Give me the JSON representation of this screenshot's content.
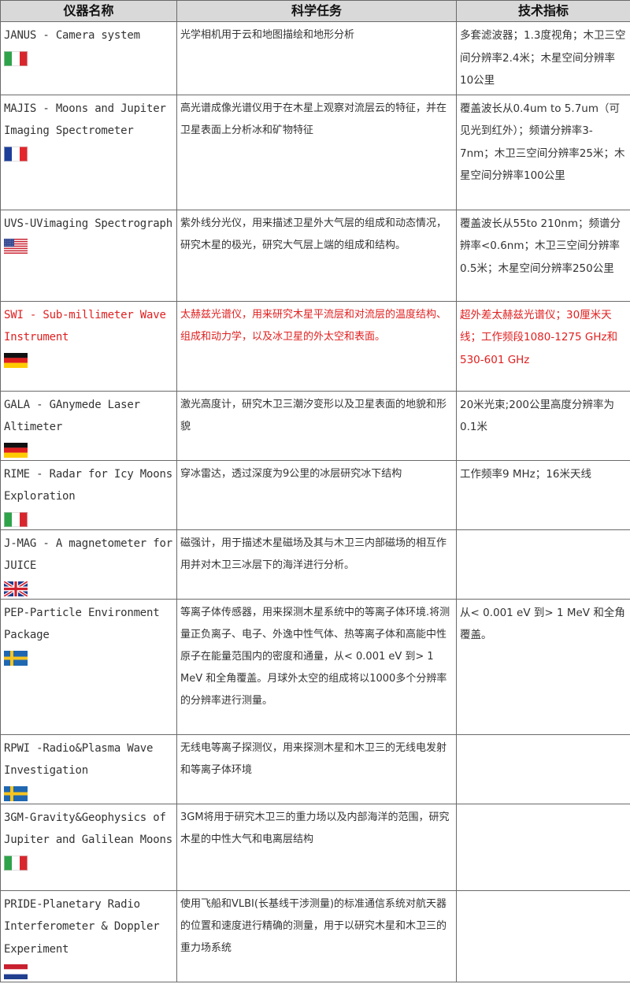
{
  "headers": [
    "仪器名称",
    "科学任务",
    "技术指标"
  ],
  "rows": [
    {
      "name": "JANUS - Camera system",
      "task": "光学相机用于云和地图描绘和地形分析",
      "spec": "多套滤波器；1.3度视角；木卫三空间分辨率2.4米；木星空间分辨率10公里",
      "flag": "italy-flag",
      "highlight": false
    },
    {
      "name": "MAJIS - Moons and Jupiter Imaging Spectrometer",
      "task": "高光谱成像光谱仪用于在木星上观察对流层云的特征，并在卫星表面上分析冰和矿物特征",
      "spec": "覆盖波长从0.4um to 5.7um（可见光到红外）；频谱分辨率3-7nm；木卫三空间分辨率25米；木星空间分辨率100公里",
      "flag": "france-flag",
      "highlight": false
    },
    {
      "name": "UVS-UVimaging Spectrograph",
      "task": "紫外线分光仪，用来描述卫星外大气层的组成和动态情况，研究木星的极光，研究大气层上端的组成和结构。",
      "spec": "覆盖波长从55to 210nm；频谱分辨率<0.6nm；木卫三空间分辨率0.5米；木星空间分辨率250公里",
      "flag": "usa-flag",
      "highlight": false
    },
    {
      "name": "SWI - Sub-millimeter Wave Instrument",
      "task": "太赫兹光谱仪，用来研究木星平流层和对流层的温度结构、组成和动力学，以及冰卫星的外太空和表面。",
      "spec": "超外差太赫兹光谱仪；30厘米天线；工作频段1080-1275 GHz和530-601 GHz",
      "flag": "germany-flag",
      "highlight": true
    },
    {
      "name": "GALA - GAnymede Laser Altimeter",
      "task": "激光高度计，研究木卫三潮汐变形以及卫星表面的地貌和形貌",
      "spec": "20米光束;200公里高度分辨率为0.1米",
      "flag": "germany-flag",
      "highlight": false
    },
    {
      "name": "RIME - Radar for Icy Moons Exploration",
      "task": "穿冰雷达，透过深度为9公里的冰层研究冰下结构",
      "spec": "工作频率9 MHz；16米天线",
      "flag": "italy-flag",
      "highlight": false
    },
    {
      "name": "J-MAG - A magnetometer for JUICE",
      "task": "磁强计，用于描述木星磁场及其与木卫三内部磁场的相互作用并对木卫三冰层下的海洋进行分析。",
      "spec": "",
      "flag": "uk-flag",
      "highlight": false
    },
    {
      "name": "PEP-Particle Environment Package",
      "task": "等离子体传感器，用来探测木星系统中的等离子体环境.将测量正负离子、电子、外逸中性气体、热等离子体和高能中性原子在能量范围内的密度和通量，从< 0.001 eV 到> 1 MeV 和全角覆盖。月球外太空的组成将以1000多个分辨率的分辨率进行测量。",
      "spec": "从< 0.001 eV 到> 1 MeV 和全角覆盖。",
      "flag": "sweden-flag",
      "highlight": false
    },
    {
      "name": "RPWI -Radio&Plasma Wave Investigation",
      "task": "无线电等离子探测仪，用来探测木星和木卫三的无线电发射和等离子体环境",
      "spec": "",
      "flag": "sweden-flag",
      "highlight": false
    },
    {
      "name": "3GM-Gravity&Geophysics of Jupiter and Galilean Moons",
      "task": "3GM将用于研究木卫三的重力场以及内部海洋的范围，研究木星的中性大气和电离层结构",
      "spec": "",
      "flag": "italy-flag",
      "highlight": false
    },
    {
      "name": "PRIDE-Planetary Radio Interferometer & Doppler Experiment",
      "task": "使用飞船和VLBI(长基线干涉测量)的标准通信系统对航天器的位置和速度进行精确的测量，用于以研究木星和木卫三的重力场系统",
      "spec": "",
      "flag": "netherlands-flag",
      "highlight": false
    }
  ],
  "colors": {
    "border": "#6a6a6a",
    "header_bg": "#d9d9d9",
    "text": "#333333",
    "highlight_text": "#e02020"
  }
}
